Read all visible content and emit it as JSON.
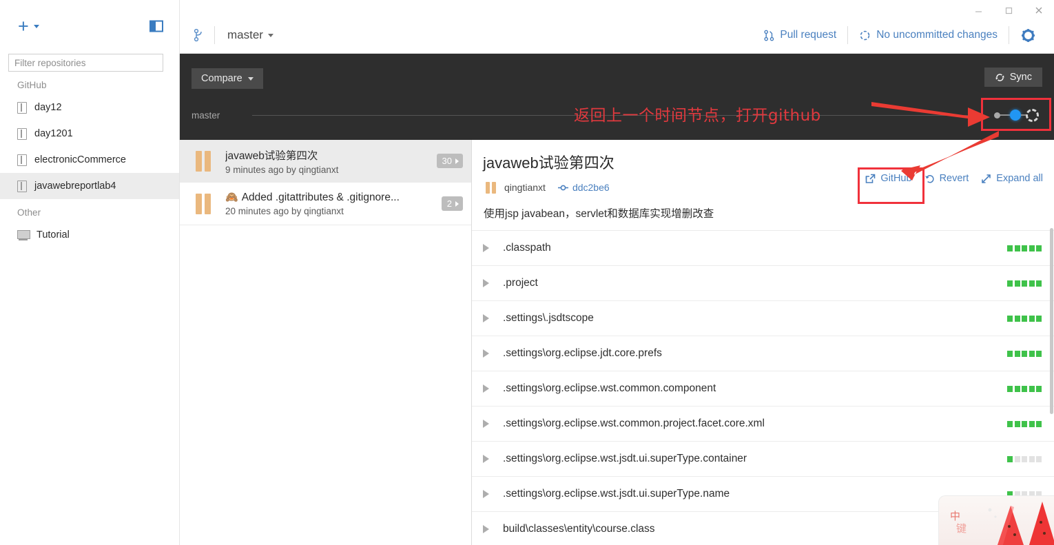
{
  "window": {
    "minimize": "—",
    "maximize": "□",
    "close": "✕"
  },
  "sidebar": {
    "add_button_label": "+",
    "panel_toggle_name": "toggle-sidebar",
    "filter": {
      "placeholder": "Filter repositories",
      "value": ""
    },
    "groups": [
      {
        "title": "GitHub",
        "items": [
          {
            "label": "day12",
            "icon": "repo-icon",
            "active": false
          },
          {
            "label": "day1201",
            "icon": "repo-icon",
            "active": false
          },
          {
            "label": "electronicCommerce",
            "icon": "repo-icon",
            "active": false
          },
          {
            "label": "javawebreportlab4",
            "icon": "repo-icon",
            "active": true
          }
        ]
      },
      {
        "title": "Other",
        "items": [
          {
            "label": "Tutorial",
            "icon": "monitor-icon",
            "active": false
          }
        ]
      }
    ]
  },
  "header": {
    "branch_icon": "branch-icon",
    "branch_name": "master",
    "pull_request_label": "Pull request",
    "uncommitted_label": "No uncommitted changes",
    "settings_icon": "gear-icon"
  },
  "compare_bar": {
    "compare_label": "Compare",
    "sync_label": "Sync",
    "timeline_branch_label": "master"
  },
  "annotation": {
    "text": "返回上一个时间节点，打开github",
    "color": "#e0393e",
    "box_color": "#f0313b"
  },
  "commits": [
    {
      "title": "javaweb试验第四次",
      "emoji": "",
      "subtitle": "9 minutes ago by qingtianxt",
      "badge": "30",
      "selected": true
    },
    {
      "title": "Added .gitattributes & .gitignore...",
      "emoji": "🙈",
      "subtitle": "20 minutes ago by qingtianxt",
      "badge": "2",
      "selected": false
    }
  ],
  "detail": {
    "title": "javaweb试验第四次",
    "author": "qingtianxt",
    "sha": "ddc2be6",
    "description": "使用jsp javabean，servlet和数据库实现增删改查",
    "actions": [
      {
        "label": "GitHub",
        "icon": "external-link-icon"
      },
      {
        "label": "Revert",
        "icon": "undo-icon"
      },
      {
        "label": "Expand all",
        "icon": "expand-icon"
      }
    ],
    "files": [
      {
        "name": ".classpath",
        "diff_filled": 5,
        "diff_total": 5
      },
      {
        "name": ".project",
        "diff_filled": 5,
        "diff_total": 5
      },
      {
        "name": ".settings\\.jsdtscope",
        "diff_filled": 5,
        "diff_total": 5
      },
      {
        "name": ".settings\\org.eclipse.jdt.core.prefs",
        "diff_filled": 5,
        "diff_total": 5
      },
      {
        "name": ".settings\\org.eclipse.wst.common.component",
        "diff_filled": 5,
        "diff_total": 5
      },
      {
        "name": ".settings\\org.eclipse.wst.common.project.facet.core.xml",
        "diff_filled": 5,
        "diff_total": 5
      },
      {
        "name": ".settings\\org.eclipse.wst.jsdt.ui.superType.container",
        "diff_filled": 1,
        "diff_total": 5
      },
      {
        "name": ".settings\\org.eclipse.wst.jsdt.ui.superType.name",
        "diff_filled": 1,
        "diff_total": 5
      },
      {
        "name": "build\\classes\\entity\\course.class",
        "diff_filled": 0,
        "diff_total": 5
      }
    ]
  },
  "ime_popup": {
    "label": "中",
    "sublabel": "键"
  },
  "colors": {
    "accent_blue": "#4a80bf",
    "dark_bar": "#2e2e2e",
    "diff_green": "#3fc24a",
    "avatar_tan": "#eab87e",
    "annotation_red": "#f0313b",
    "timeline_blue": "#2196f3"
  }
}
